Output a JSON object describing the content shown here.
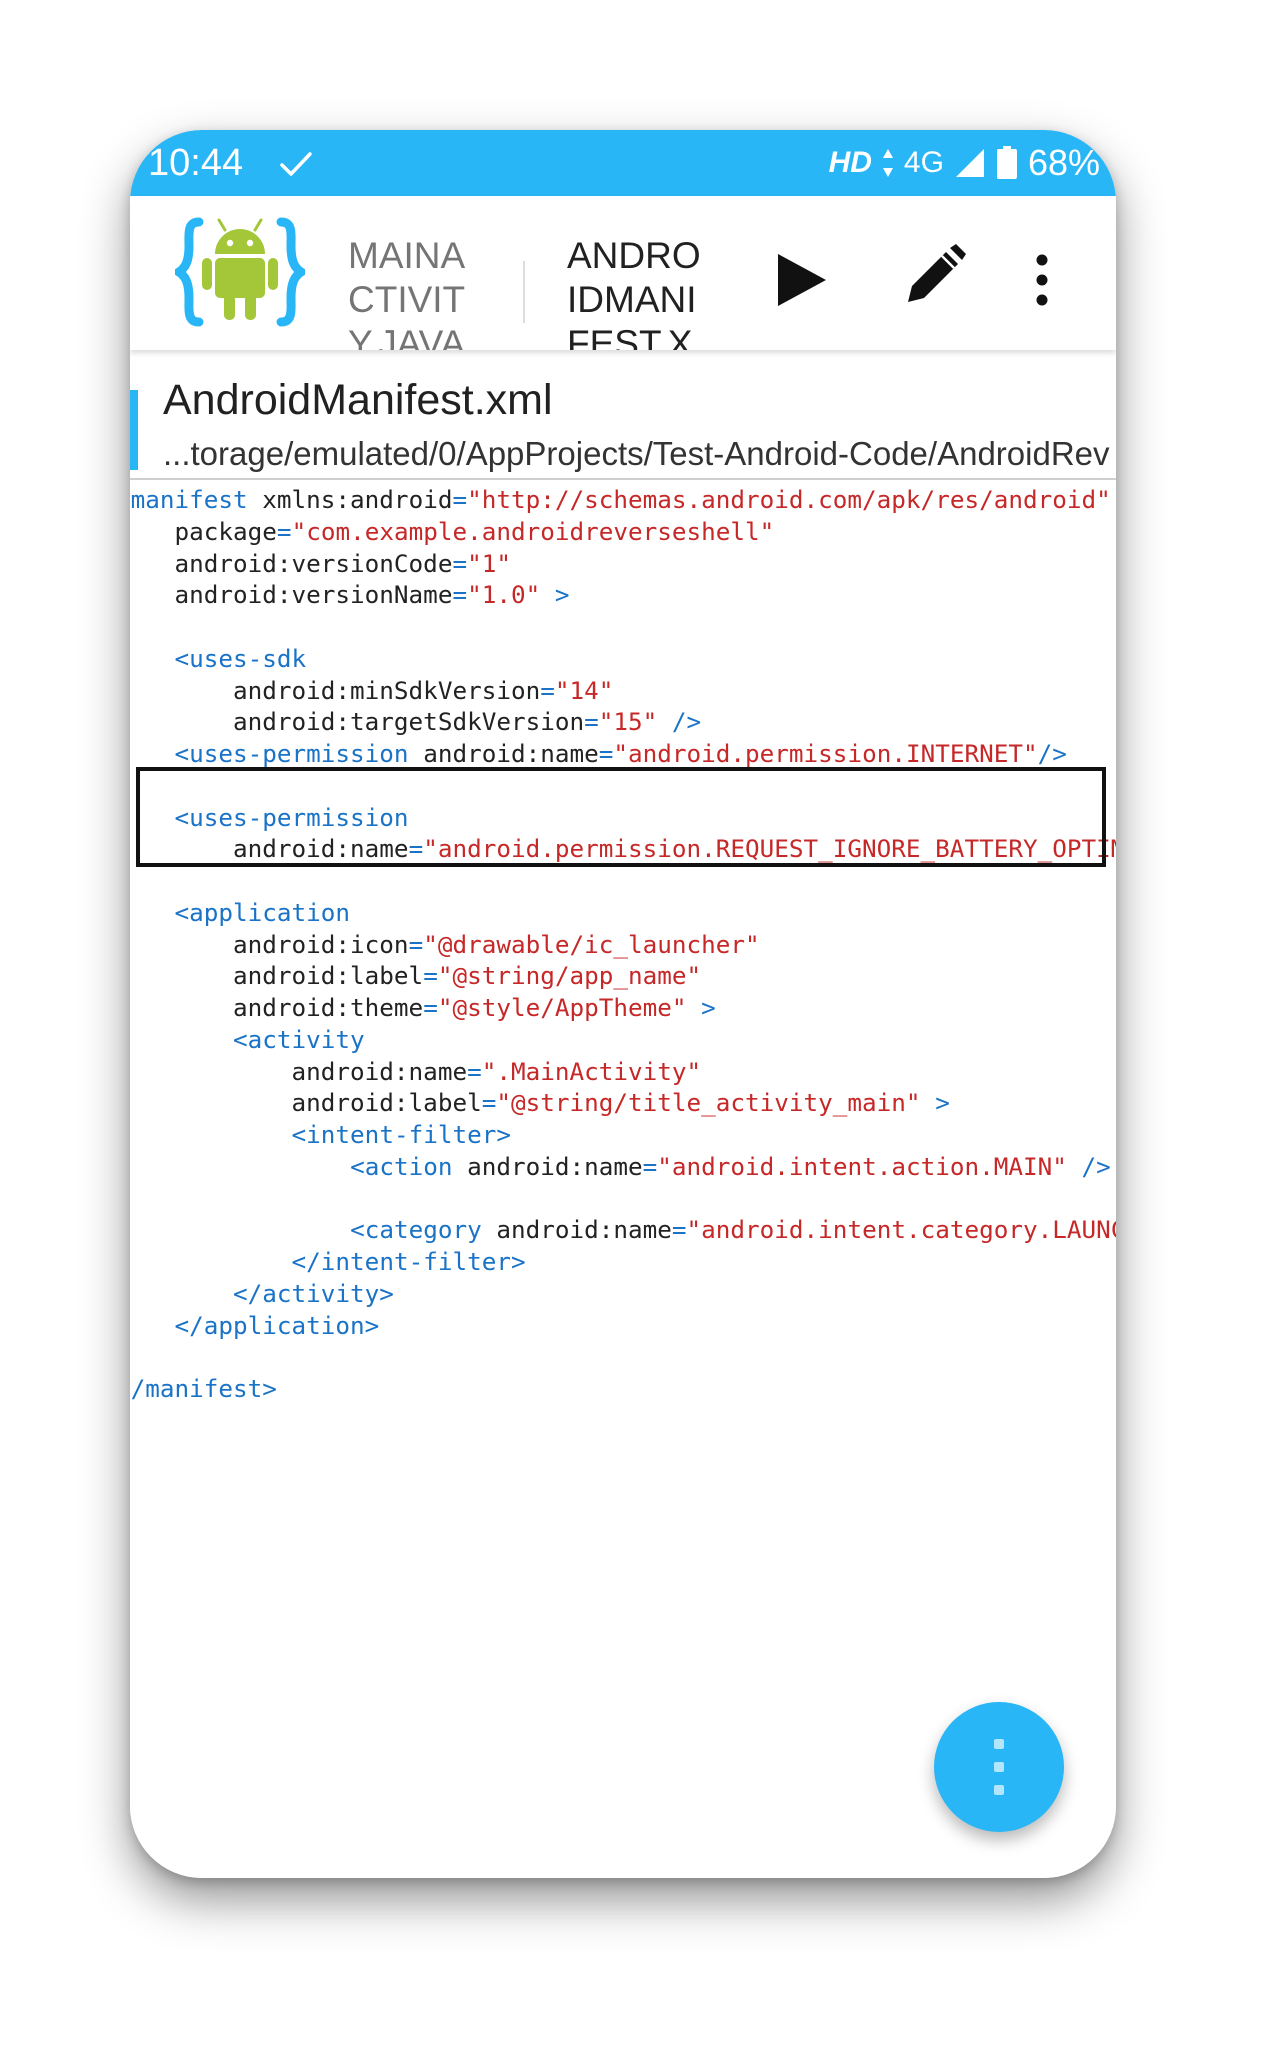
{
  "status_bar": {
    "time": "10:44",
    "hd": "HD",
    "network": "4G",
    "battery": "68%"
  },
  "toolbar": {
    "tabs": [
      {
        "label": "MAINACTIVITY.JAVA",
        "active": false
      },
      {
        "label": "ANDROIDMANIFEST.X",
        "active": true
      }
    ]
  },
  "file": {
    "name": "AndroidManifest.xml",
    "path": "...torage/emulated/0/AppProjects/Test-Android-Code/AndroidRev"
  },
  "code_lines": [
    [
      [
        "t",
        "<manifest"
      ],
      [
        "a",
        " xmlns:android"
      ],
      [
        "e",
        "="
      ],
      [
        "v",
        "\"http://schemas.android.com/apk/res/android\""
      ]
    ],
    [
      [
        "a",
        "    package"
      ],
      [
        "e",
        "="
      ],
      [
        "v",
        "\"com.example.androidreverseshell\""
      ]
    ],
    [
      [
        "a",
        "    android:versionCode"
      ],
      [
        "e",
        "="
      ],
      [
        "v",
        "\"1\""
      ]
    ],
    [
      [
        "a",
        "    android:versionName"
      ],
      [
        "e",
        "="
      ],
      [
        "v",
        "\"1.0\""
      ],
      [
        "t",
        " >"
      ]
    ],
    [],
    [
      [
        "a",
        "    "
      ],
      [
        "t",
        "<uses-sdk"
      ]
    ],
    [
      [
        "a",
        "        android:minSdkVersion"
      ],
      [
        "e",
        "="
      ],
      [
        "v",
        "\"14\""
      ]
    ],
    [
      [
        "a",
        "        android:targetSdkVersion"
      ],
      [
        "e",
        "="
      ],
      [
        "v",
        "\"15\""
      ],
      [
        "t",
        " />"
      ]
    ],
    [
      [
        "a",
        "    "
      ],
      [
        "t",
        "<uses-permission"
      ],
      [
        "a",
        " android:name"
      ],
      [
        "e",
        "="
      ],
      [
        "v",
        "\"android.permission.INTERNET\""
      ],
      [
        "t",
        "/>"
      ]
    ],
    [],
    [
      [
        "a",
        "    "
      ],
      [
        "t",
        "<uses-permission"
      ]
    ],
    [
      [
        "a",
        "        android:name"
      ],
      [
        "e",
        "="
      ],
      [
        "v",
        "\"android.permission.REQUEST_IGNORE_BATTERY_OPTIMIZATIONS\""
      ],
      [
        "t",
        "/>"
      ]
    ],
    [],
    [
      [
        "a",
        "    "
      ],
      [
        "t",
        "<application"
      ]
    ],
    [
      [
        "a",
        "        android:icon"
      ],
      [
        "e",
        "="
      ],
      [
        "v",
        "\"@drawable/ic_launcher\""
      ]
    ],
    [
      [
        "a",
        "        android:label"
      ],
      [
        "e",
        "="
      ],
      [
        "v",
        "\"@string/app_name\""
      ]
    ],
    [
      [
        "a",
        "        android:theme"
      ],
      [
        "e",
        "="
      ],
      [
        "v",
        "\"@style/AppTheme\""
      ],
      [
        "t",
        " >"
      ]
    ],
    [
      [
        "a",
        "        "
      ],
      [
        "t",
        "<activity"
      ]
    ],
    [
      [
        "a",
        "            android:name"
      ],
      [
        "e",
        "="
      ],
      [
        "v",
        "\".MainActivity\""
      ]
    ],
    [
      [
        "a",
        "            android:label"
      ],
      [
        "e",
        "="
      ],
      [
        "v",
        "\"@string/title_activity_main\""
      ],
      [
        "t",
        " >"
      ]
    ],
    [
      [
        "a",
        "            "
      ],
      [
        "t",
        "<intent-filter>"
      ]
    ],
    [
      [
        "a",
        "                "
      ],
      [
        "t",
        "<action"
      ],
      [
        "a",
        " android:name"
      ],
      [
        "e",
        "="
      ],
      [
        "v",
        "\"android.intent.action.MAIN\""
      ],
      [
        "t",
        " />"
      ]
    ],
    [],
    [
      [
        "a",
        "                "
      ],
      [
        "t",
        "<category"
      ],
      [
        "a",
        " android:name"
      ],
      [
        "e",
        "="
      ],
      [
        "v",
        "\"android.intent.category.LAUNCHER\""
      ],
      [
        "t",
        " />"
      ]
    ],
    [
      [
        "a",
        "            "
      ],
      [
        "t",
        "</intent-filter>"
      ]
    ],
    [
      [
        "a",
        "        "
      ],
      [
        "t",
        "</activity>"
      ]
    ],
    [
      [
        "a",
        "    "
      ],
      [
        "t",
        "</application>"
      ]
    ],
    [],
    [
      [
        "t",
        "</manifest>"
      ]
    ]
  ],
  "colors": {
    "accent": "#29b6f6",
    "tag": "#1a73c7",
    "value": "#c62828",
    "attr": "#222222"
  },
  "fab": {
    "icon": "more-vertical-icon"
  }
}
